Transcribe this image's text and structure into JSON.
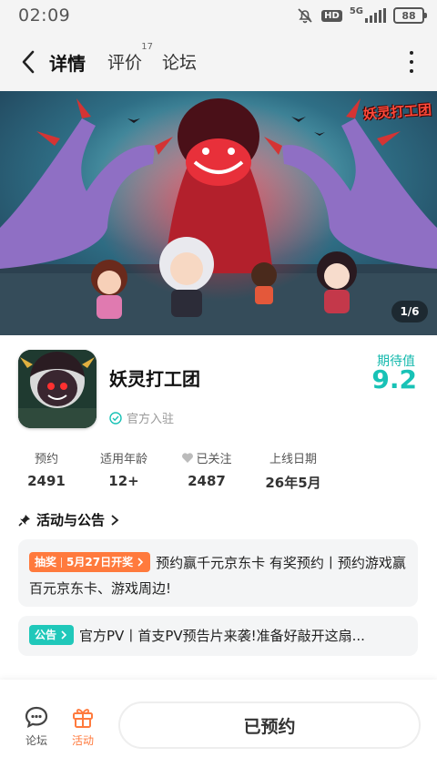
{
  "status_bar": {
    "time": "02:09",
    "hd": "HD",
    "network": "5G",
    "battery": "88"
  },
  "nav": {
    "tabs": [
      {
        "label": "详情",
        "active": true
      },
      {
        "label": "评价",
        "badge": "17"
      },
      {
        "label": "论坛"
      }
    ],
    "back_icon": "chevron-left-icon",
    "more_icon": "more-vertical-icon"
  },
  "banner": {
    "counter": "1/6",
    "logo_text": "妖灵打工团"
  },
  "game": {
    "title": "妖灵打工团",
    "official_label": "官方入驻",
    "expect_label": "期待值",
    "expect_score": "9.2"
  },
  "stats": [
    {
      "label": "预约",
      "value": "2491"
    },
    {
      "label": "适用年龄",
      "value": "12+"
    },
    {
      "label": "已关注",
      "value": "2487"
    },
    {
      "label": "上线日期",
      "value": "26年5月"
    }
  ],
  "activities": {
    "header": "活动与公告",
    "items": [
      {
        "tag_main": "抽奖",
        "tag_sub": "5月27日开奖",
        "text": "预约赢千元京东卡 有奖预约丨预约游戏赢百元京东卡、游戏周边!"
      },
      {
        "tag_main": "公告",
        "text": "官方PV丨首支PV预告片来袭!准备好敲开这扇..."
      }
    ]
  },
  "bottom_bar": {
    "forum_label": "论坛",
    "activity_label": "活动",
    "reserve_button": "已预约"
  },
  "colors": {
    "accent_teal": "#18c2b6",
    "accent_orange": "#ff7a3d"
  }
}
